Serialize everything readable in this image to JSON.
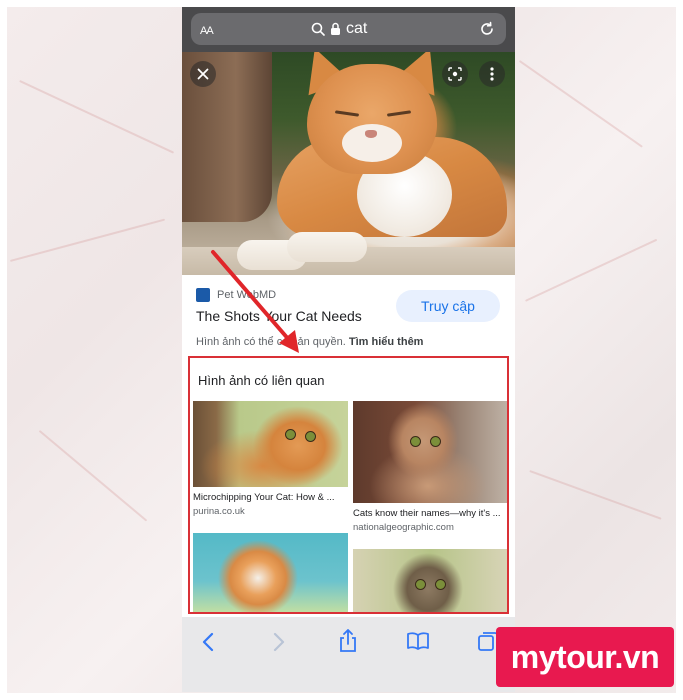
{
  "browser": {
    "text_size_label": "AA",
    "url_text": "cat"
  },
  "result": {
    "source_name": "Pet WebMD",
    "title": "The Shots Your Cat Needs",
    "visit_button": "Truy cập",
    "copyright_text": "Hình ảnh có thể có bản quyền.",
    "learn_more": "Tìm hiểu thêm"
  },
  "related": {
    "heading": "Hình ảnh có liên quan",
    "items": [
      {
        "title": "Microchipping Your Cat: How & ...",
        "domain": "purina.co.uk"
      },
      {
        "title": "Cats know their names—why it's ...",
        "domain": "nationalgeographic.com"
      },
      {
        "title": "",
        "domain": ""
      },
      {
        "title": "",
        "domain": ""
      }
    ]
  },
  "watermark": {
    "text": "mytour.vn"
  },
  "colors": {
    "highlight": "#d93036",
    "link_blue": "#1a73e8",
    "watermark_bg": "#e8194f",
    "arrow": "#e0262a"
  },
  "icons": [
    "close-icon",
    "lens-icon",
    "more-vert-icon",
    "search-icon",
    "lock-icon",
    "reload-icon",
    "back-icon",
    "forward-icon",
    "share-icon",
    "bookmarks-icon",
    "tabs-icon"
  ]
}
